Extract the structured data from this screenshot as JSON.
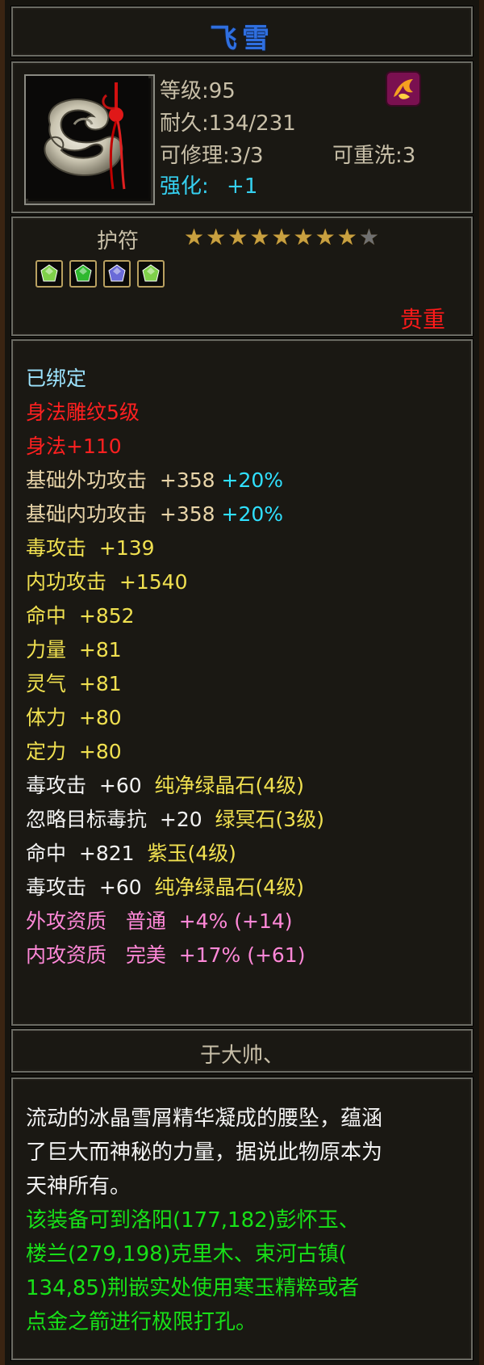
{
  "item": {
    "name": "飞雪",
    "level": "等级:95",
    "durability": "耐久:134/231",
    "repair": "可修理:3/3",
    "rewash": "可重洗:3",
    "enhance_label": "强化:",
    "enhance_value": "+1",
    "type": "护符",
    "stars_filled": 8,
    "stars_total": 9,
    "rarity": "贵重",
    "maker": "于大帅、"
  },
  "gems": [
    {
      "color": "#7fd04a",
      "icon": "green-gem-icon"
    },
    {
      "color": "#2fb82f",
      "icon": "green-leaf-gem-icon"
    },
    {
      "color": "#6a6ad8",
      "icon": "purple-gem-icon"
    },
    {
      "color": "#7fd04a",
      "icon": "green-gem-icon"
    }
  ],
  "attributes": {
    "bound": "已绑定",
    "carve": "身法雕纹5级",
    "agility": "身法+110",
    "rows": [
      {
        "label": "基础外功攻击",
        "value": "+358",
        "extra": "+20%"
      },
      {
        "label": "基础内功攻击",
        "value": "+358",
        "extra": "+20%"
      },
      {
        "label": "毒攻击",
        "value": "+139"
      },
      {
        "label": "内功攻击",
        "value": "+1540"
      },
      {
        "label": "命中",
        "value": "+852"
      },
      {
        "label": "力量",
        "value": "+81"
      },
      {
        "label": "灵气",
        "value": "+81"
      },
      {
        "label": "体力",
        "value": "+80"
      },
      {
        "label": "定力",
        "value": "+80"
      }
    ],
    "gem_rows": [
      {
        "label": "毒攻击",
        "value": "+60",
        "gem": "纯净绿晶石(4级)"
      },
      {
        "label": "忽略目标毒抗",
        "value": "+20",
        "gem": "绿冥石(3级)"
      },
      {
        "label": "命中",
        "value": "+821",
        "gem": "紫玉(4级)"
      },
      {
        "label": "毒攻击",
        "value": "+60",
        "gem": "纯净绿晶石(4级)"
      }
    ],
    "quality_rows": [
      {
        "label": "外攻资质",
        "grade": "普通",
        "value": "+4%",
        "paren": "(+14)"
      },
      {
        "label": "内攻资质",
        "grade": "完美",
        "value": "+17%",
        "paren": "(+61)"
      }
    ]
  },
  "description": {
    "lore_1": "流动的冰晶雪屑精华凝成的腰坠，蕴涵",
    "lore_2": "了巨大而神秘的力量，据说此物原本为",
    "lore_3": "天神所有。",
    "hint_1": "该装备可到洛阳(177,182)彭怀玉、",
    "hint_2": "楼兰(279,198)克里木、束河古镇(",
    "hint_3": "134,85)荆嵌实处使用寒玉精粹或者",
    "hint_4": "点金之箭进行极限打孔。"
  }
}
